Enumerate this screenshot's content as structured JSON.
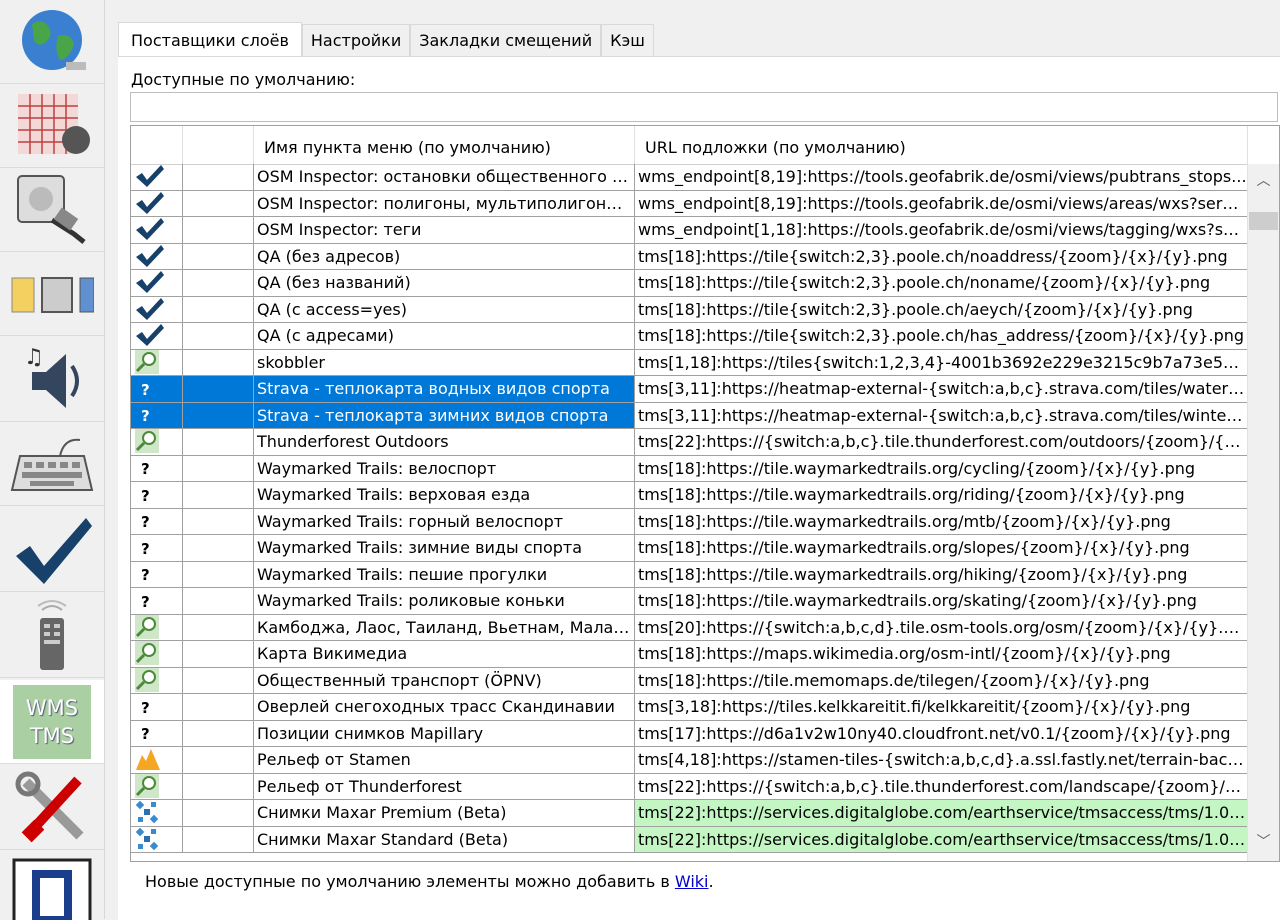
{
  "sidebar": {
    "items": [
      {
        "name": "display-settings",
        "icon": "globe-icon"
      },
      {
        "name": "projection-settings",
        "icon": "map-grid-icon"
      },
      {
        "name": "connection-settings",
        "icon": "plug-icon"
      },
      {
        "name": "advanced-settings",
        "icon": "folders-icon"
      },
      {
        "name": "audio-settings",
        "icon": "speaker-icon"
      },
      {
        "name": "shortcut-settings",
        "icon": "keyboard-icon"
      },
      {
        "name": "validator-settings",
        "icon": "checkmark-icon"
      },
      {
        "name": "remote-control-settings",
        "icon": "remote-control-icon"
      },
      {
        "name": "imagery-settings",
        "icon": "wms-tms-icon",
        "label_top": "WMS",
        "label_bottom": "TMS",
        "active": true
      },
      {
        "name": "plugin-settings",
        "icon": "tools-icon"
      },
      {
        "name": "map-paint-settings",
        "icon": "square-icon"
      }
    ]
  },
  "tabs": [
    {
      "label": "Поставщики слоёв",
      "active": true
    },
    {
      "label": "Настройки",
      "active": false
    },
    {
      "label": "Закладки смещений",
      "active": false
    },
    {
      "label": "Кэш",
      "active": false
    }
  ],
  "available_label": "Доступные по умолчанию:",
  "filter": {
    "value": "",
    "placeholder": ""
  },
  "table": {
    "headers": {
      "name": "Имя пункта меню (по умолчанию)",
      "url": "URL подложки (по умолчанию)"
    },
    "rows": [
      {
        "icon": "check",
        "name": "OSM Inspector: остановки общественного т...",
        "url": "wms_endpoint[8,19]:https://tools.geofabrik.de/osmi/views/pubtrans_stops..."
      },
      {
        "icon": "check",
        "name": "OSM Inspector: полигоны, мультиполигоны ...",
        "url": "wms_endpoint[8,19]:https://tools.geofabrik.de/osmi/views/areas/wxs?servi..."
      },
      {
        "icon": "check",
        "name": "OSM Inspector: теги",
        "url": "wms_endpoint[1,18]:https://tools.geofabrik.de/osmi/views/tagging/wxs?se..."
      },
      {
        "icon": "check",
        "name": "QA (без адресов)",
        "url": "tms[18]:https://tile{switch:2,3}.poole.ch/noaddress/{zoom}/{x}/{y}.png"
      },
      {
        "icon": "check",
        "name": "QA (без названий)",
        "url": "tms[18]:https://tile{switch:2,3}.poole.ch/noname/{zoom}/{x}/{y}.png"
      },
      {
        "icon": "check",
        "name": "QA (с access=yes)",
        "url": "tms[18]:https://tile{switch:2,3}.poole.ch/aeych/{zoom}/{x}/{y}.png"
      },
      {
        "icon": "check",
        "name": "QA (с адресами)",
        "url": "tms[18]:https://tile{switch:2,3}.poole.ch/has_address/{zoom}/{x}/{y}.png"
      },
      {
        "icon": "magnifier",
        "name": "skobbler",
        "url": "tms[1,18]:https://tiles{switch:1,2,3,4}-4001b3692e229e3215c9b7a73e528..."
      },
      {
        "icon": "question",
        "name": "Strava - теплокарта водных видов спорта",
        "url": "tms[3,11]:https://heatmap-external-{switch:a,b,c}.strava.com/tiles/water/b...",
        "selected": true
      },
      {
        "icon": "question",
        "name": "Strava - теплокарта зимних видов спорта",
        "url": "tms[3,11]:https://heatmap-external-{switch:a,b,c}.strava.com/tiles/winter/...",
        "selected": true
      },
      {
        "icon": "magnifier",
        "name": "Thunderforest Outdoors",
        "url": "tms[22]:https://{switch:a,b,c}.tile.thunderforest.com/outdoors/{zoom}/{x}/..."
      },
      {
        "icon": "question",
        "name": "Waymarked Trails: велоспорт",
        "url": "tms[18]:https://tile.waymarkedtrails.org/cycling/{zoom}/{x}/{y}.png"
      },
      {
        "icon": "question",
        "name": "Waymarked Trails: верховая езда",
        "url": "tms[18]:https://tile.waymarkedtrails.org/riding/{zoom}/{x}/{y}.png"
      },
      {
        "icon": "question",
        "name": "Waymarked Trails: горный велоспорт",
        "url": "tms[18]:https://tile.waymarkedtrails.org/mtb/{zoom}/{x}/{y}.png"
      },
      {
        "icon": "question",
        "name": "Waymarked Trails: зимние виды спорта",
        "url": "tms[18]:https://tile.waymarkedtrails.org/slopes/{zoom}/{x}/{y}.png"
      },
      {
        "icon": "question",
        "name": "Waymarked Trails: пешие прогулки",
        "url": "tms[18]:https://tile.waymarkedtrails.org/hiking/{zoom}/{x}/{y}.png"
      },
      {
        "icon": "question",
        "name": "Waymarked Trails: роликовые коньки",
        "url": "tms[18]:https://tile.waymarkedtrails.org/skating/{zoom}/{x}/{y}.png"
      },
      {
        "icon": "magnifier",
        "name": "Камбоджа, Лаос, Таиланд, Вьетнам, Малай...",
        "url": "tms[20]:https://{switch:a,b,c,d}.tile.osm-tools.org/osm/{zoom}/{x}/{y}.png"
      },
      {
        "icon": "magnifier",
        "name": "Карта Викимедиа",
        "url": "tms[18]:https://maps.wikimedia.org/osm-intl/{zoom}/{x}/{y}.png"
      },
      {
        "icon": "magnifier",
        "name": "Общественный транспорт (ÖPNV)",
        "url": "tms[18]:https://tile.memomaps.de/tilegen/{zoom}/{x}/{y}.png"
      },
      {
        "icon": "question",
        "name": "Оверлей снегоходных трасс Скандинавии",
        "url": "tms[3,18]:https://tiles.kelkkareitit.fi/kelkkareitit/{zoom}/{x}/{y}.png"
      },
      {
        "icon": "question",
        "name": "Позиции снимков Mapillary",
        "url": "tms[17]:https://d6a1v2w10ny40.cloudfront.net/v0.1/{zoom}/{x}/{y}.png"
      },
      {
        "icon": "stamen",
        "name": "Рельеф от Stamen",
        "url": "tms[4,18]:https://stamen-tiles-{switch:a,b,c,d}.a.ssl.fastly.net/terrain-backg..."
      },
      {
        "icon": "magnifier",
        "name": "Рельеф от Thunderforest",
        "url": "tms[22]:https://{switch:a,b,c}.tile.thunderforest.com/landscape/{zoom}/{x..."
      },
      {
        "icon": "satellite",
        "name": "Снимки Maxar Premium (Beta)",
        "url": "tms[22]:https://services.digitalglobe.com/earthservice/tmsaccess/tms/1.0.0...",
        "green": true
      },
      {
        "icon": "satellite",
        "name": "Снимки Maxar Standard (Beta)",
        "url": "tms[22]:https://services.digitalglobe.com/earthservice/tmsaccess/tms/1.0.0...",
        "green": true
      }
    ]
  },
  "footer": {
    "text": "Новые доступные по умолчанию элементы можно добавить в ",
    "link": "Wiki",
    "after": "."
  },
  "colors": {
    "selection": "#0078d7",
    "green_row": "#c4f6c4",
    "check": "#17416a"
  }
}
